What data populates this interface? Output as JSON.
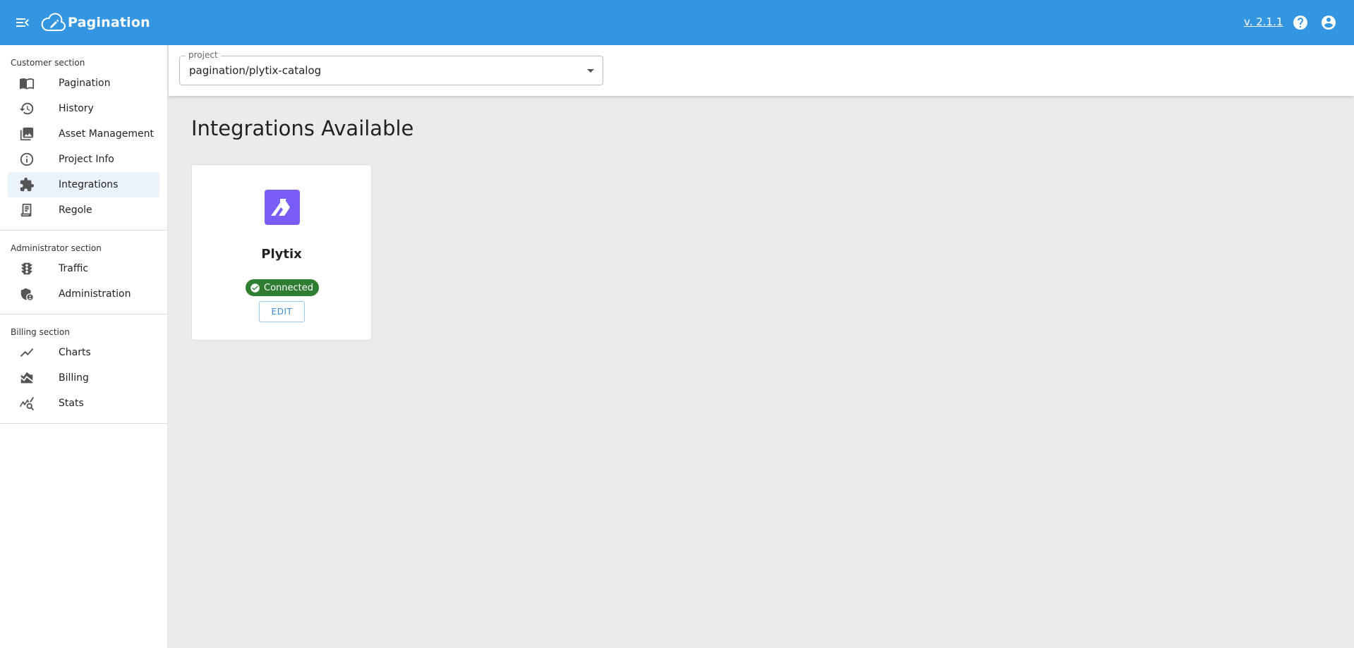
{
  "app": {
    "name": "Pagination",
    "version": "v. 2.1.1",
    "brand_color": "#3495e1"
  },
  "sidebar": {
    "sections": [
      {
        "title": "Customer section",
        "items": [
          {
            "label": "Pagination",
            "icon": "book-open-icon"
          },
          {
            "label": "History",
            "icon": "history-icon"
          },
          {
            "label": "Asset Management",
            "icon": "photo-library-icon"
          },
          {
            "label": "Project Info",
            "icon": "info-icon"
          },
          {
            "label": "Integrations",
            "icon": "puzzle-icon",
            "active": true
          },
          {
            "label": "Regole",
            "icon": "receipt-icon"
          }
        ]
      },
      {
        "title": "Administrator section",
        "items": [
          {
            "label": "Traffic",
            "icon": "traffic-light-icon"
          },
          {
            "label": "Administration",
            "icon": "admin-shield-icon"
          }
        ]
      },
      {
        "title": "Billing section",
        "items": [
          {
            "label": "Charts",
            "icon": "trending-line-icon"
          },
          {
            "label": "Billing",
            "icon": "area-chart-icon"
          },
          {
            "label": "Stats",
            "icon": "query-stats-icon"
          }
        ]
      }
    ]
  },
  "project": {
    "label": "project",
    "value": "pagination/plytix-catalog"
  },
  "main": {
    "title": "Integrations Available",
    "integrations": [
      {
        "name": "Plytix",
        "logo_color": "#7a5cf7",
        "status": "Connected",
        "status_color": "#2e7d32",
        "action": "EDIT"
      }
    ]
  }
}
